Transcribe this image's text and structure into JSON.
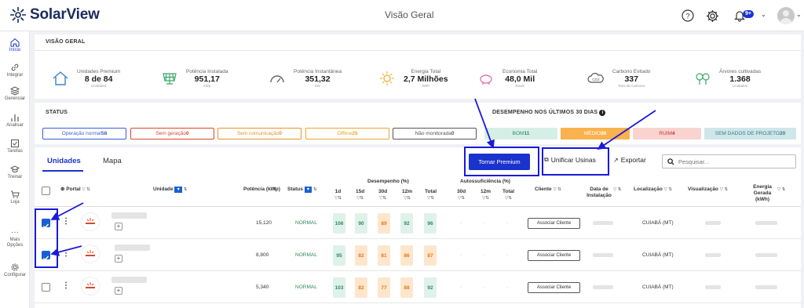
{
  "header": {
    "brand": "SolarView",
    "title": "Visão Geral",
    "notif_badge": "9+"
  },
  "sidebar": {
    "items": [
      {
        "label": "Início"
      },
      {
        "label": "Integrar"
      },
      {
        "label": "Gerenciar"
      },
      {
        "label": "Analisar"
      },
      {
        "label": "Tarefas"
      },
      {
        "label": "Treinar"
      },
      {
        "label": "Loja"
      },
      {
        "label": "Mais Opções"
      },
      {
        "label": "Configurar"
      }
    ]
  },
  "overview": {
    "title": "VISÃO GERAL",
    "kpis": [
      {
        "label": "Unidades Premium",
        "value": "8 de 84",
        "unit": "Unidades",
        "icon": "house-icon"
      },
      {
        "label": "Potência Instalada",
        "value": "951,17",
        "unit": "kWp",
        "icon": "solar-panel-icon"
      },
      {
        "label": "Potência Instantânea",
        "value": "351,32",
        "unit": "kW",
        "icon": "gauge-icon"
      },
      {
        "label": "Energia Total",
        "value": "2,7 Milhões",
        "unit": "kWh",
        "icon": "sun-icon"
      },
      {
        "label": "Economia Total",
        "value": "48,0 Mil",
        "unit": "Reais",
        "icon": "piggy-bank-icon"
      },
      {
        "label": "Carbono Evitado",
        "value": "337",
        "unit": "Tons de Carbono",
        "icon": "co2-cloud-icon"
      },
      {
        "label": "Árvores cultivadas",
        "value": "1.368",
        "unit": "Unidades",
        "icon": "trees-icon"
      }
    ]
  },
  "status": {
    "title": "STATUS",
    "buttons": [
      {
        "label": "Operação normal",
        "count": "58",
        "color": "#3a5bd9"
      },
      {
        "label": "Sem geração",
        "count": "0",
        "color": "#d9472b"
      },
      {
        "label": "Sem comunicação",
        "count": "0",
        "color": "#e8912a"
      },
      {
        "label": "Offline",
        "count": "25",
        "color": "#e8a52a"
      },
      {
        "label": "Não monitorada",
        "count": "0",
        "color": "#555555"
      }
    ]
  },
  "performance": {
    "title": "DESEMPENHO NOS ÚLTIMOS 30 DIAS",
    "buttons": [
      {
        "label": "BOM",
        "count": "11",
        "bg": "#d6efe6",
        "fg": "#2f8a5e"
      },
      {
        "label": "MÉDIO",
        "count": "30",
        "bg": "#f9b24e",
        "fg": "#ffffff"
      },
      {
        "label": "RUIM",
        "count": "4",
        "bg": "#f9d3cf",
        "fg": "#c0392b"
      },
      {
        "label": "SEM DADOS DE PROJETO",
        "count": "20",
        "bg": "#cfe6ea",
        "fg": "#3a7a86"
      }
    ]
  },
  "toolbar": {
    "tab_units": "Unidades",
    "tab_map": "Mapa",
    "premium_button": "Tornar Premium",
    "unify_button": "Unificar Usinas",
    "export_button": "Exportar",
    "search_placeholder": "Pesquisar..."
  },
  "table": {
    "headers": {
      "portal": "Portal",
      "unit": "Unidade",
      "power": "Potência (kWp)",
      "status": "Status",
      "desempenho": "Desempenho (%)",
      "d1": "1d",
      "d15": "15d",
      "d30": "30d",
      "m12": "12m",
      "total": "Total",
      "autossuf": "Autossuficiência (%)",
      "a30": "30d",
      "a12m": "12m",
      "atotal": "Total",
      "client": "Cliente",
      "install_date": "Data de Instalação",
      "location": "Localização",
      "visualization": "Visualização",
      "energy": "Energia Gerada (kWh)"
    },
    "rows": [
      {
        "checked": true,
        "power": "15,120",
        "status": "NORMAL",
        "perf": [
          "106",
          "90",
          "89",
          "92",
          "96"
        ],
        "client_btn": "Associar Cliente",
        "location": "CUIABÁ (MT)"
      },
      {
        "checked": true,
        "power": "8,800",
        "status": "NORMAL",
        "perf": [
          "95",
          "82",
          "81",
          "86",
          "87"
        ],
        "client_btn": "Associar Cliente",
        "location": "CUIABÁ (MT)"
      },
      {
        "checked": false,
        "power": "5,340",
        "status": "NORMAL",
        "perf": [
          "103",
          "82",
          "77",
          "88",
          "92"
        ],
        "client_btn": "Associar Cliente",
        "location": "CUIABÁ (MT)"
      }
    ],
    "perf_colors": [
      [
        "g",
        "g",
        "o",
        "g",
        "g"
      ],
      [
        "g",
        "o",
        "o",
        "o",
        "o"
      ],
      [
        "g",
        "o",
        "o",
        "o",
        "g"
      ]
    ],
    "row_dash": "-"
  }
}
